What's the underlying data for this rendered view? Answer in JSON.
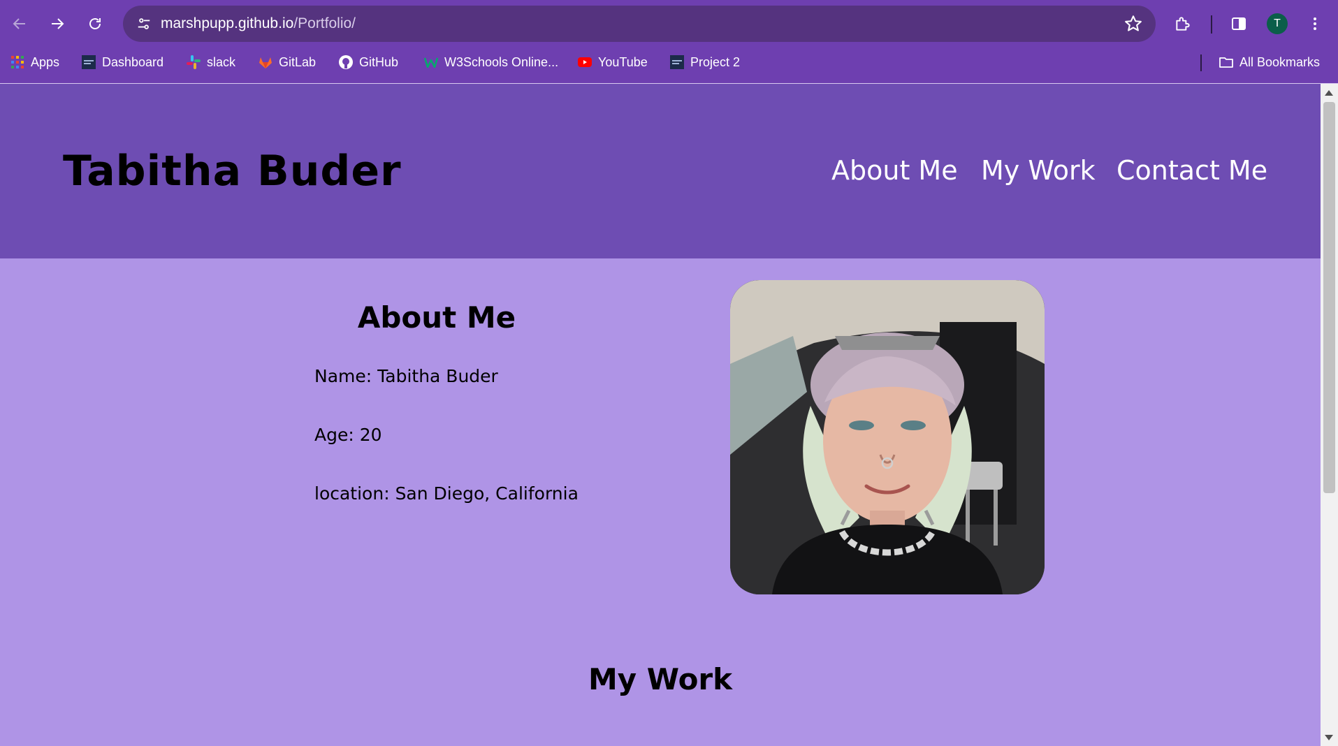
{
  "browser": {
    "url_host": "marshpupp.github.io",
    "url_path": "/Portfolio/",
    "profile_initial": "T",
    "bookmarks": [
      {
        "label": "Apps",
        "icon": "apps-grid-icon"
      },
      {
        "label": "Dashboard",
        "icon": "dashboard-favicon-icon"
      },
      {
        "label": "slack",
        "icon": "slack-icon"
      },
      {
        "label": "GitLab",
        "icon": "gitlab-icon"
      },
      {
        "label": "GitHub",
        "icon": "github-icon"
      },
      {
        "label": "W3Schools Online...",
        "icon": "w3schools-icon"
      },
      {
        "label": "YouTube",
        "icon": "youtube-icon"
      },
      {
        "label": "Project 2",
        "icon": "project-favicon-icon"
      }
    ],
    "all_bookmarks": "All Bookmarks",
    "colors": {
      "chrome": "#6e3fb0",
      "omnibox": "#55337f"
    }
  },
  "site": {
    "title": "Tabitha Buder",
    "nav": [
      "About Me",
      "My Work",
      "Contact Me"
    ],
    "colors": {
      "header": "#6e4db3",
      "background": "#af94e6"
    }
  },
  "about": {
    "heading": "About Me",
    "name": "Name: Tabitha Buder",
    "age": "Age: 20",
    "location": "location: San Diego, California"
  },
  "work": {
    "heading": "My Work"
  }
}
